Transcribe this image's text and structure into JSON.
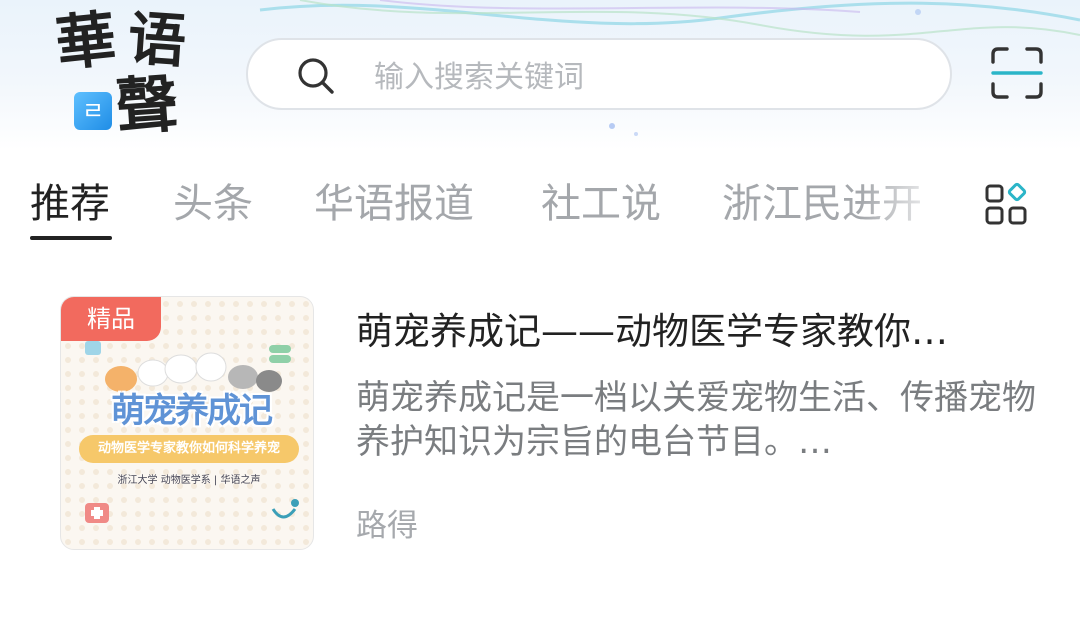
{
  "app": {
    "logo_chars": [
      "華",
      "语",
      "聲"
    ],
    "logo_badge": "ㄹ"
  },
  "search": {
    "placeholder": "输入搜索关键词",
    "icon": "search-icon"
  },
  "scan": {
    "icon": "scan-icon"
  },
  "tabs": [
    {
      "label": "推荐",
      "active": true
    },
    {
      "label": "头条",
      "active": false
    },
    {
      "label": "华语报道",
      "active": false
    },
    {
      "label": "社工说",
      "active": false
    },
    {
      "label": "浙江民进开",
      "active": false
    }
  ],
  "channel_menu": {
    "icon": "channel-grid-icon"
  },
  "feed": [
    {
      "tag": "精品",
      "thumb_title": "萌宠养成记",
      "thumb_subtitle": "动物医学专家教你如何科学养宠",
      "thumb_org": "浙江大学 动物医学系 | 华语之声",
      "title": "萌宠养成记——动物医学专家教你…",
      "description": "萌宠养成记是一档以关爱宠物生活、传播宠物养护知识为宗旨的电台节目。…",
      "author": "路得"
    }
  ],
  "colors": {
    "accent_tag": "#f26a5e",
    "active_tab": "#222222",
    "inactive_tab": "#a4a7ab",
    "scan_accent": "#2bb5c8"
  }
}
